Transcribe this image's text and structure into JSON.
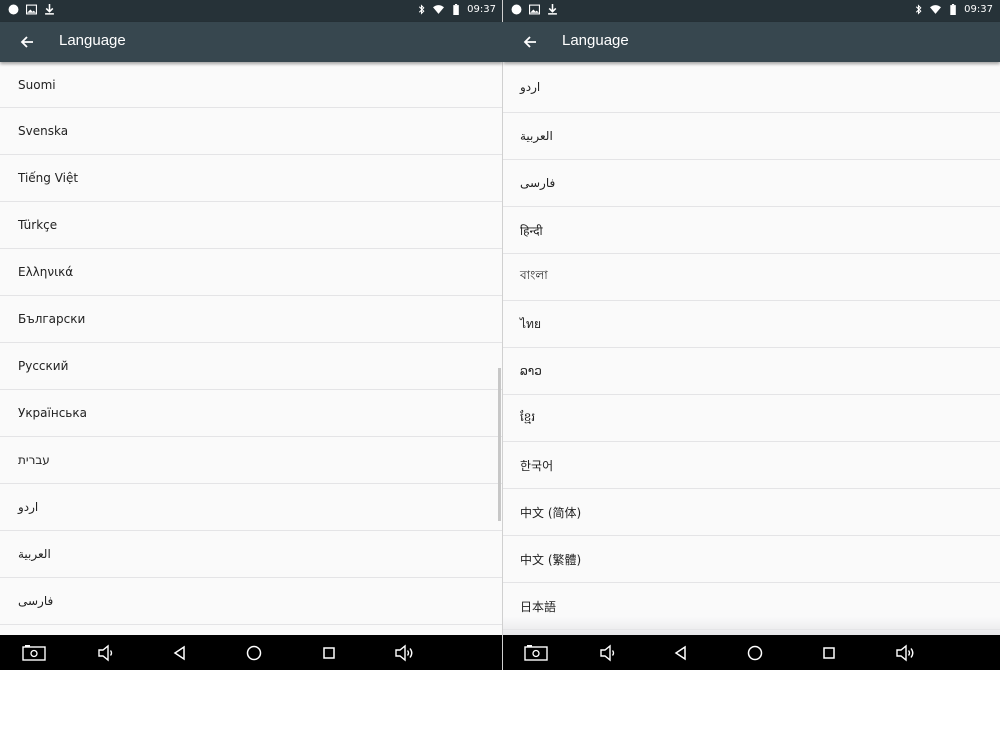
{
  "status_bar": {
    "time": "09:37"
  },
  "left": {
    "title": "Language",
    "items": [
      "Suomi",
      "Svenska",
      "Tiếng Việt",
      "Türkçe",
      "Ελληνικά",
      "Български",
      "Русский",
      "Українська",
      "עברית",
      "اردو",
      "العربية",
      "فارسی"
    ]
  },
  "right": {
    "title": "Language",
    "items": [
      "اردو",
      "العربية",
      "فارسی",
      "हिन्दी",
      "বাংলা",
      "ไทย",
      "ລາວ",
      "ខ្មែរ",
      "한국어",
      "中文 (简体)",
      "中文 (繁體)",
      "日本語"
    ]
  },
  "colors": {
    "status_bar": "#263238",
    "app_bar": "#37474f",
    "list_bg": "#fafafa",
    "nav_bar": "#000000"
  },
  "icons": {
    "status_left": [
      "circle-icon",
      "image-icon",
      "download-icon"
    ],
    "status_right": [
      "bluetooth-icon",
      "wifi-icon",
      "battery-icon"
    ],
    "nav": [
      "screenshot-icon",
      "volume-down-icon",
      "back-icon",
      "home-icon",
      "recents-icon",
      "volume-up-icon"
    ]
  }
}
